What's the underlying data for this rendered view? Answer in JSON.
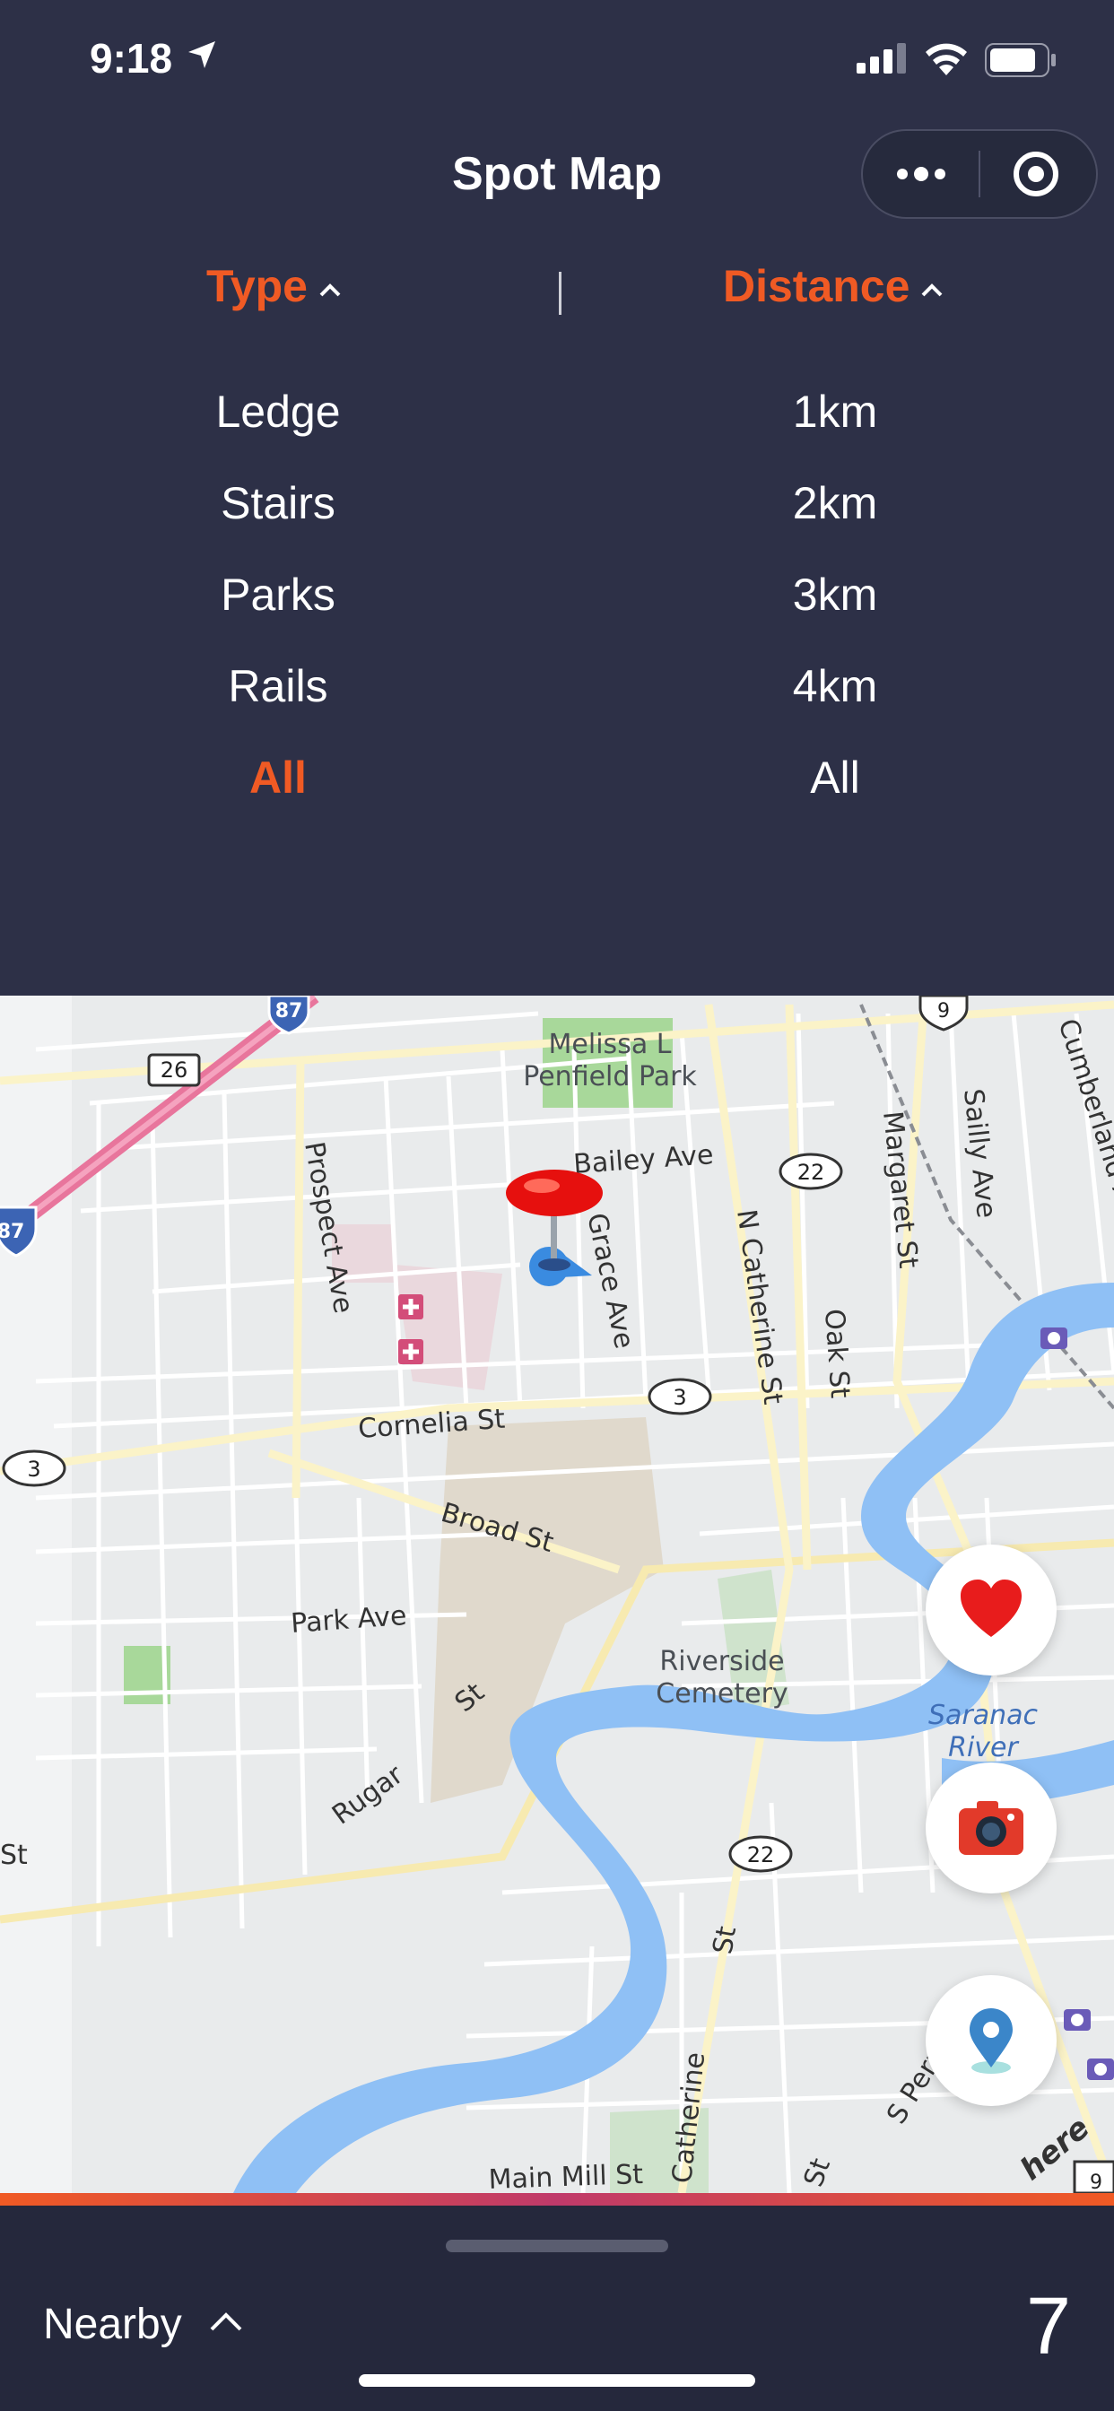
{
  "status": {
    "time": "9:18"
  },
  "nav": {
    "title": "Spot Map"
  },
  "filters": {
    "type": {
      "label": "Type",
      "options": [
        "Ledge",
        "Stairs",
        "Parks",
        "Rails",
        "All"
      ],
      "selected": "All"
    },
    "distance": {
      "label": "Distance",
      "options": [
        "1km",
        "2km",
        "3km",
        "4km",
        "All"
      ]
    }
  },
  "map": {
    "labels": {
      "park": "Melissa L",
      "park2": "Penfield Park",
      "bailey": "Bailey  Ave",
      "prospect": "Prospect  Ave",
      "grace": "Grace  Ave",
      "ncatherine": "N  Catherine  St",
      "oak": "Oak  St",
      "margaret": "Margaret  St",
      "sailly": "Sailly  Ave",
      "cumberland": "Cumberland  Ave",
      "cornelia": "Cornelia  St",
      "broad": "Broad  St",
      "park_ave": "Park  Ave",
      "rugar": "Rugar",
      "st1": "St",
      "st_left": "St",
      "riverside": "Riverside",
      "cemetery": "Cemetery",
      "saranac": "Saranac",
      "river": "River",
      "catherine": "Catherine",
      "st2": "St",
      "s_peru": "S  Peru  St",
      "main_mill": "Main  Mill  St",
      "st3": "St",
      "here": "here"
    },
    "shields": {
      "i87a": "87",
      "i87b": "87",
      "r26": "26",
      "r22a": "22",
      "r22b": "22",
      "r3a": "3",
      "r3b": "3",
      "us9a": "9",
      "us9b": "9"
    }
  },
  "bottom": {
    "label": "Nearby",
    "count": "7"
  },
  "colors": {
    "accent": "#f05a24",
    "background": "#2d3047"
  }
}
